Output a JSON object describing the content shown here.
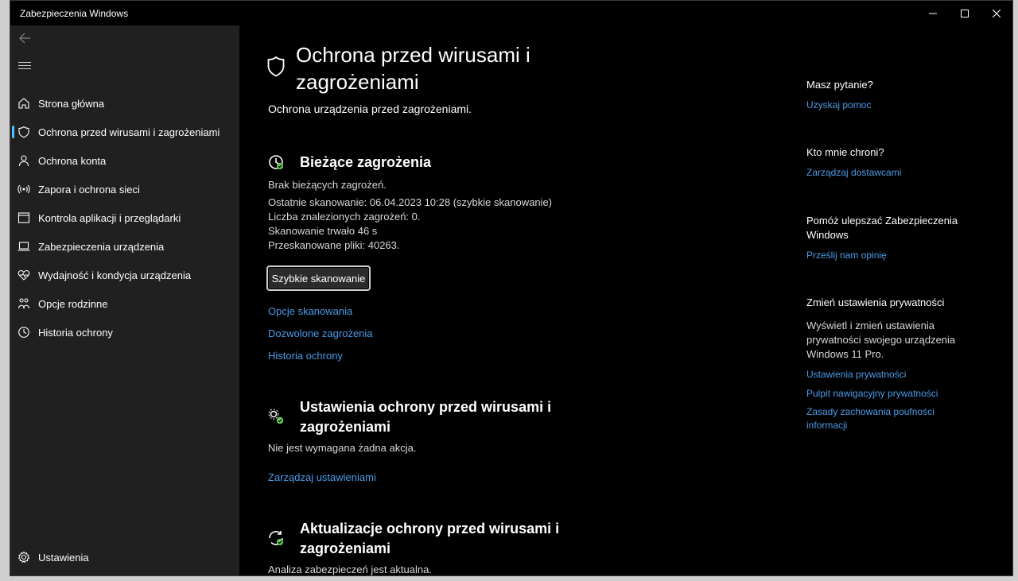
{
  "window": {
    "title": "Zabezpieczenia Windows"
  },
  "sidebar": {
    "items": [
      {
        "label": "Strona główna",
        "icon": "home-icon"
      },
      {
        "label": "Ochrona przed wirusami i zagrożeniami",
        "icon": "shield-icon",
        "active": true
      },
      {
        "label": "Ochrona konta",
        "icon": "person-icon"
      },
      {
        "label": "Zapora i ochrona sieci",
        "icon": "network-icon"
      },
      {
        "label": "Kontrola aplikacji i przeglądarki",
        "icon": "app-browser-icon"
      },
      {
        "label": "Zabezpieczenia urządzenia",
        "icon": "laptop-icon"
      },
      {
        "label": "Wydajność i kondycja urządzenia",
        "icon": "heart-icon"
      },
      {
        "label": "Opcje rodzinne",
        "icon": "family-icon"
      },
      {
        "label": "Historia ochrony",
        "icon": "history-icon"
      }
    ],
    "settings_label": "Ustawienia"
  },
  "main": {
    "title": "Ochrona przed wirusami i zagrożeniami",
    "subtitle": "Ochrona urządzenia przed zagrożeniami.",
    "current_threats": {
      "title": "Bieżące zagrożenia",
      "lines": [
        "Brak bieżących zagrożeń.",
        "Ostatnie skanowanie: 06.04.2023 10:28 (szybkie skanowanie)",
        "Liczba znalezionych zagrożeń: 0.",
        "Skanowanie trwało 46 s",
        "Przeskanowane pliki: 40263."
      ],
      "button": "Szybkie skanowanie",
      "links": [
        "Opcje skanowania",
        "Dozwolone zagrożenia",
        "Historia ochrony"
      ]
    },
    "settings_section": {
      "title": "Ustawienia ochrony przed wirusami i zagrożeniami",
      "text": "Nie jest wymagana żadna akcja.",
      "link": "Zarządzaj ustawieniami"
    },
    "updates_section": {
      "title": "Aktualizacje ochrony przed wirusami i zagrożeniami",
      "text": "Analiza zabezpieczeń jest aktualna."
    }
  },
  "right_panel": {
    "question": {
      "heading": "Masz pytanie?",
      "link": "Uzyskaj pomoc"
    },
    "who_protects": {
      "heading": "Kto mnie chroni?",
      "link": "Zarządzaj dostawcami"
    },
    "improve": {
      "heading": "Pomóż ulepszać Zabezpieczenia Windows",
      "link": "Prześlij nam opinię"
    },
    "privacy": {
      "heading": "Zmień ustawienia prywatności",
      "text": "Wyświetl i zmień ustawienia prywatności swojego urządzenia Windows 11 Pro.",
      "links": [
        "Ustawienia prywatności",
        "Pulpit nawigacyjny prywatności",
        "Zasady zachowania poufności informacji"
      ]
    }
  },
  "colors": {
    "accent": "#4cc2ff",
    "link": "#4c9be8",
    "sidebar_bg": "#202020",
    "main_bg": "#000000",
    "status_ok": "#6ccb5f"
  }
}
